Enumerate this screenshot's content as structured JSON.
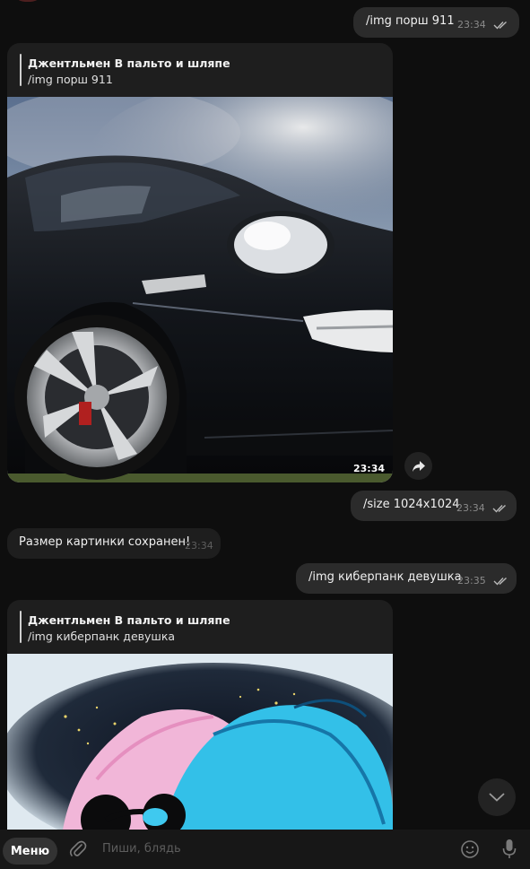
{
  "messages": {
    "m1": {
      "text": "/img порш 911",
      "time": "23:34"
    },
    "m2": {
      "reply_author": "Джентльмен В пальто и шляпе",
      "reply_text": "/img порш 911",
      "image": "porsche-911-photo",
      "time": "23:34"
    },
    "m3": {
      "text": "/size 1024x1024",
      "time": "23:34"
    },
    "m4": {
      "text": "Размер картинки сохранен!",
      "time": "23:34"
    },
    "m5": {
      "text": "/img киберпанк девушка",
      "time": "23:35"
    },
    "m6": {
      "reply_author": "Джентльмен В пальто и шляпе",
      "reply_text": "/img киберпанк девушка",
      "image": "cyberpunk-girl-art"
    }
  },
  "composer": {
    "menu_label": "Меню",
    "placeholder": "Пиши, блядь",
    "icons": [
      "attach-icon",
      "emoji-icon",
      "microphone-icon"
    ]
  },
  "controls": {
    "share_icon": "share-icon",
    "scroll_icon": "chevron-down-icon"
  },
  "colors": {
    "background": "#0e0e0e",
    "outgoing": "#2b2b2b",
    "incoming": "#1e1e1e"
  }
}
